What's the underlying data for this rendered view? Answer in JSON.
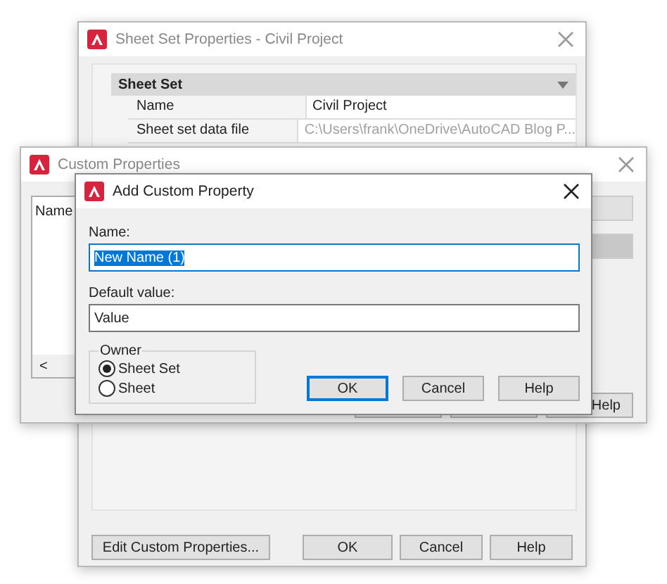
{
  "back_window": {
    "title": "Sheet Set Properties - Civil Project",
    "section": {
      "title": "Sheet Set",
      "expanded": true
    },
    "rows": [
      {
        "name": "Name",
        "value": "Civil Project",
        "disabled": false
      },
      {
        "name": "Sheet set data file",
        "value": "C:\\Users\\frank\\OneDrive\\AutoCAD Blog P...",
        "disabled": true
      }
    ],
    "buttons": [
      "Edit Custom Properties...",
      "OK",
      "Cancel",
      "Help"
    ]
  },
  "middle_window": {
    "title": "Custom Properties",
    "list_header": "Name",
    "scroll_left": "<",
    "buttons": [
      "Help"
    ]
  },
  "dialog": {
    "title": "Add Custom Property",
    "fields": [
      {
        "label": "Name:",
        "value": "New Name (1)",
        "highlighted": true
      },
      {
        "label": "Default value:",
        "value": "Value",
        "highlighted": false
      }
    ],
    "owner": {
      "title": "Owner",
      "options": [
        {
          "label": "Sheet Set",
          "selected": true
        },
        {
          "label": "Sheet",
          "selected": false
        }
      ]
    },
    "buttons": [
      {
        "label": "OK",
        "default": true
      },
      {
        "label": "Cancel",
        "default": false
      },
      {
        "label": "Help",
        "default": false
      }
    ]
  }
}
